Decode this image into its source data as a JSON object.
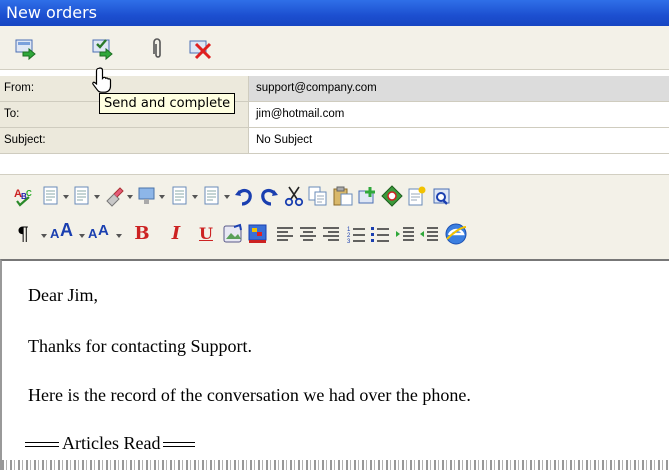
{
  "window": {
    "title": "New orders"
  },
  "toolbar": {
    "buttons": [
      {
        "icon": "send-icon",
        "label": "Send"
      },
      {
        "icon": "send-and-complete-icon",
        "label": "Send and complete"
      },
      {
        "icon": "paperclip-icon",
        "label": "Attach"
      },
      {
        "icon": "discard-icon",
        "label": "Discard"
      }
    ],
    "tooltip": "Send and complete"
  },
  "fields": {
    "from": {
      "label": "From:",
      "value": "support@company.com"
    },
    "to": {
      "label": "To:",
      "value": "jim@hotmail.com"
    },
    "subject": {
      "label": "Subject:",
      "value": "No Subject"
    }
  },
  "editor_toolbar": {
    "row1_icons": [
      "spellcheck-icon",
      "template-icon",
      "template2-icon",
      "format-painter-icon",
      "insert-image-icon",
      "template3-icon",
      "template4-icon",
      "undo-icon",
      "redo-icon",
      "cut-icon",
      "copy-icon",
      "paste-icon",
      "insert-link-icon",
      "special-char-icon",
      "edit-icon",
      "find-icon"
    ],
    "row2_icons": [
      "paragraph-icon",
      "font-size-up-icon",
      "font-size-down-icon",
      "bold-icon",
      "italic-icon",
      "underline-icon",
      "insert-picture-icon",
      "text-color-icon",
      "align-left-icon",
      "align-center-icon",
      "align-right-icon",
      "numbered-list-icon",
      "bullet-list-icon",
      "indent-icon",
      "outdent-icon",
      "browser-icon"
    ],
    "labels": {
      "bold": "B",
      "italic": "I",
      "underline": "U",
      "paragraph": "¶",
      "font_up": "A",
      "font_down": "A"
    }
  },
  "message": {
    "greeting": "Dear Jim,",
    "line1": "Thanks for contacting Support.",
    "line2": "Here is the record of the conversation we had over the phone.",
    "section": "Articles Read"
  }
}
